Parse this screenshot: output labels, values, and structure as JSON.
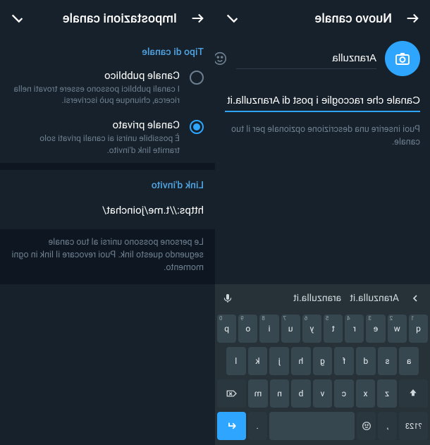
{
  "left": {
    "title": "Nuovo canale",
    "channel_name": "Aranzulla",
    "description_value": "Canale che raccoglie i post di Aranzulla.it",
    "description_placeholder": "Puoi inserire una descrizione opzionale per il tuo canale."
  },
  "right": {
    "title": "Impostazioni canale",
    "section_type": "Tipo di canale",
    "opt_public_label": "Canale pubblico",
    "opt_public_desc": "I canali pubblici possono essere trovati nella ricerca, chiunque può iscriversi.",
    "opt_private_label": "Canale privato",
    "opt_private_desc": "È possibile unirsi ai canali privati solo tramite link d'invito.",
    "section_link": "Link d'invito",
    "invite_link": "https://t.me/joinchat/",
    "link_help": "Le persone possono unirsi al tuo canale seguendo questo link. Puoi revocare il link in ogni momento."
  },
  "keyboard": {
    "sug1": "Aranzulla.it",
    "sug2": "aranzulla.it",
    "row1": [
      "q",
      "w",
      "e",
      "r",
      "t",
      "y",
      "u",
      "i",
      "o",
      "p"
    ],
    "row1_sup": [
      "1",
      "2",
      "3",
      "4",
      "5",
      "6",
      "7",
      "8",
      "9",
      "0"
    ],
    "row2": [
      "a",
      "s",
      "d",
      "f",
      "g",
      "h",
      "j",
      "k",
      "l"
    ],
    "row3": [
      "z",
      "x",
      "c",
      "v",
      "b",
      "n",
      "m"
    ],
    "sym": "?123",
    "comma": ",",
    "dot": "."
  }
}
